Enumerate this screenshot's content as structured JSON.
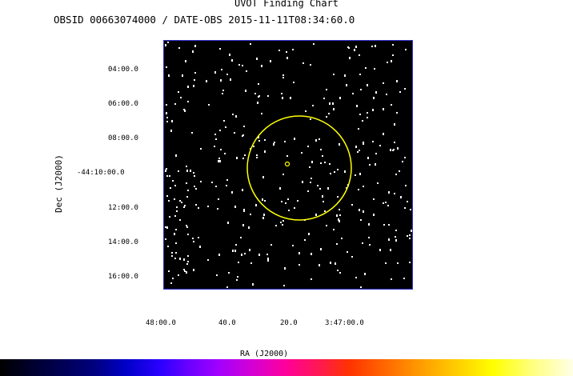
{
  "chart": {
    "title": "UVOT Finding Chart",
    "subtitle": "OBSID 00663074000 / DATE-OBS 2015-11-11T08:34:60.0",
    "ylabel": "Dec (J2000)",
    "xlabel": "RA (J2000)",
    "yticks": [
      "04:00.0",
      "06:00.0",
      "08:00.0",
      "-44:10:00.0",
      "12:00.0",
      "14:00.0",
      "16:00.0"
    ],
    "xticks": [
      "48:00.0",
      "40.0",
      "20.0",
      "3:47:00.0"
    ]
  },
  "colors": {
    "field_bg": "#000000",
    "field_border": "#3333cc",
    "marker": "#ffff00",
    "stars": "#ffffff"
  },
  "colorbar": {
    "colormap": "heat (black-blue-magenta-red-orange-yellow-white)"
  }
}
